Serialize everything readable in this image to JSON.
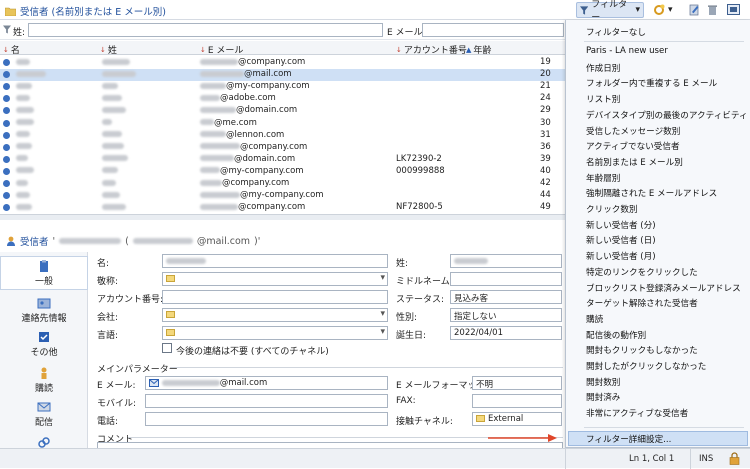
{
  "header": {
    "title": "受信者 (名前別または E メール別)",
    "filter_label": "フィルター"
  },
  "filter_row": {
    "last_name_label": "姓:",
    "email_label": "E メール:"
  },
  "table": {
    "columns": [
      "名",
      "姓",
      "E メール",
      "アカウント番号",
      "年齢"
    ],
    "rows": [
      {
        "email_domain": "@company.com",
        "account": "",
        "age": "19"
      },
      {
        "email_domain": "@mail.com",
        "account": "",
        "age": "20"
      },
      {
        "email_domain": "@my-company.com",
        "account": "",
        "age": "21"
      },
      {
        "email_domain": "@adobe.com",
        "account": "",
        "age": "24"
      },
      {
        "email_domain": "@domain.com",
        "account": "",
        "age": "29"
      },
      {
        "email_domain": "@me.com",
        "account": "",
        "age": "30"
      },
      {
        "email_domain": "@lennon.com",
        "account": "",
        "age": "31"
      },
      {
        "email_domain": "@company.com",
        "account": "",
        "age": "36"
      },
      {
        "email_domain": "@domain.com",
        "account": "LK72390-2",
        "age": "39"
      },
      {
        "email_domain": "@my-company.com",
        "account": "000999888",
        "age": "40"
      },
      {
        "email_domain": "@company.com",
        "account": "",
        "age": "42"
      },
      {
        "email_domain": "@my-company.com",
        "account": "",
        "age": "44"
      },
      {
        "email_domain": "@company.com",
        "account": "NF72800-5",
        "age": "49"
      }
    ]
  },
  "detail": {
    "title": "受信者",
    "title_email": "@mail.com",
    "nav": [
      "一般",
      "連絡先情報",
      "その他",
      "購読",
      "配信"
    ],
    "form": {
      "first_name_label": "名:",
      "last_name_label": "姓:",
      "salutation_label": "敬称:",
      "middle_name_label": "ミドルネーム:",
      "account_label": "アカウント番号:",
      "status_label": "ステータス:",
      "status_value": "見込み客",
      "company_label": "会社:",
      "gender_label": "性別:",
      "gender_value": "指定しない",
      "language_label": "言語:",
      "birth_label": "誕生日:",
      "birth_value": "2022/04/01",
      "no_contact_label": "今後の連絡は不要 (すべてのチャネル)",
      "main_params_label": "メインパラメーター",
      "email_label": "E メール:",
      "email_value": "@mail.com",
      "email_format_label": "E メールフォーマット:",
      "email_format_value": "不明",
      "mobile_label": "モバイル:",
      "fax_label": "FAX:",
      "phone_label": "電話:",
      "channel_label": "接触チャネル:",
      "channel_value": "External",
      "comment_label": "コメント"
    }
  },
  "menu": {
    "items": [
      "フィルターなし",
      "Paris - LA new user",
      "作成日別",
      "フォルダー内で重複する E メール",
      "リスト別",
      "デバイスタイプ別の最後のアクティビティ",
      "受信したメッセージ数別",
      "アクティブでない受信者",
      "名前別または E メール別",
      "年齢層別",
      "強制隔離された E メールアドレス",
      "クリック数別",
      "新しい受信者 (分)",
      "新しい受信者 (日)",
      "新しい受信者 (月)",
      "特定のリンクをクリックした",
      "ブロックリスト登録済みメールアドレス",
      "ターゲット解除された受信者",
      "購読",
      "配信後の動作別",
      "開封もクリックもしなかった",
      "開封したがクリックしなかった",
      "開封数別",
      "開封済み",
      "非常にアクティブな受信者"
    ],
    "advanced": "フィルター詳細設定..."
  },
  "status_bar": {
    "position": "Ln 1, Col 1",
    "mode": "INS"
  },
  "colors": {
    "accent": "#1f4e9b",
    "selection": "#cfe0f5",
    "arrow": "#e0462a"
  }
}
